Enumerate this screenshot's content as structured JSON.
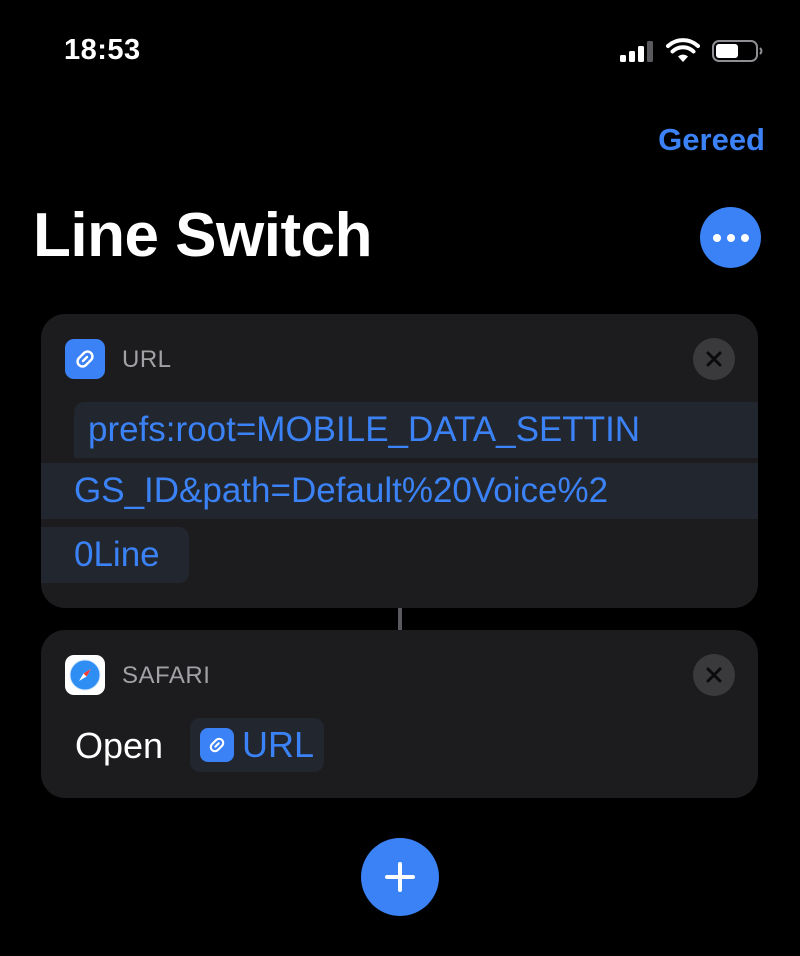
{
  "status_bar": {
    "time": "18:53"
  },
  "header": {
    "done_label": "Gereed",
    "title": "Line Switch"
  },
  "actions": [
    {
      "label": "URL",
      "url_lines": [
        "prefs:root=MOBILE_DATA_SETTIN",
        "GS_ID&path=Default%20Voice%2",
        "0Line"
      ]
    },
    {
      "label": "SAFARI",
      "verb": "Open",
      "token": "URL"
    }
  ],
  "colors": {
    "accent": "#3b82f6",
    "card": "#1c1c1e",
    "background": "#000000"
  }
}
